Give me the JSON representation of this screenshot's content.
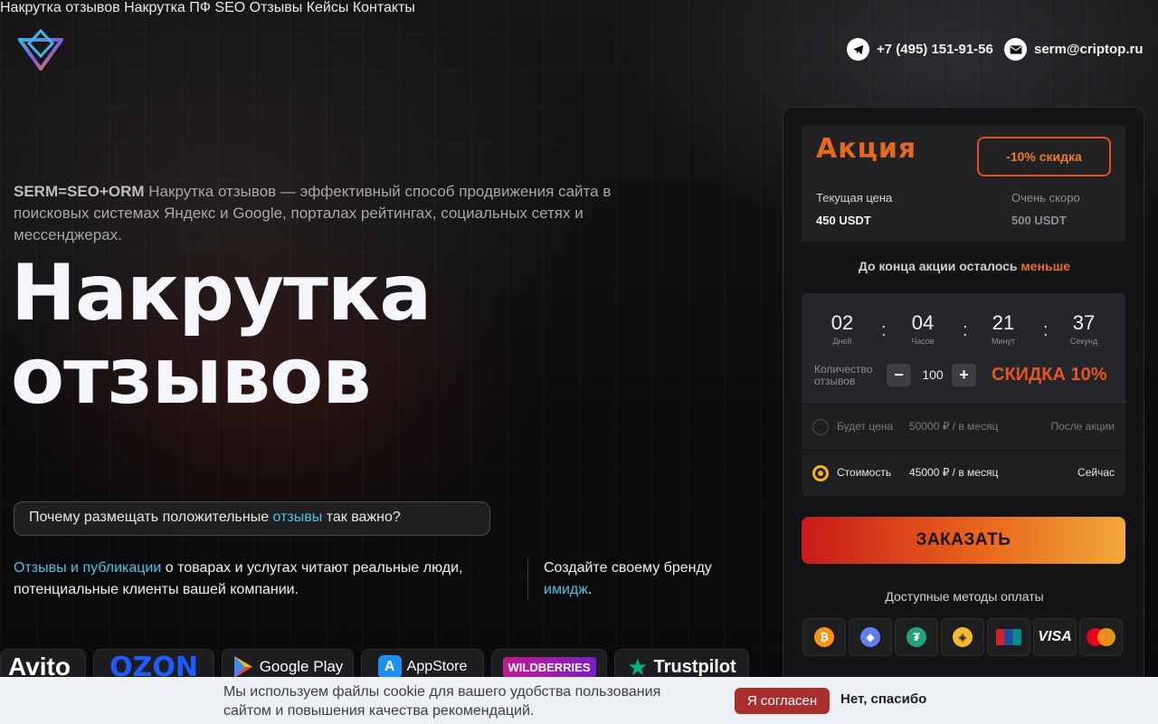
{
  "header": {
    "nav": [
      "Накрутка отзывов",
      "Накрутка ПФ",
      "SEO",
      "Отзывы",
      "Кейсы",
      "Контакты"
    ],
    "phone": "+7 (495) 151-91-56",
    "email": "serm@criptop.ru"
  },
  "hero": {
    "lead_bold": "SERM=SEO+ORM",
    "lead_text": " Накрутка отзывов — эффективный способ продвижения сайта в поисковых системах Яндекс и Google, порталах рейтингах, социальных сетях и мессенджерах.",
    "title_line1": "Накрутка",
    "title_line2": "отзывов",
    "why_pre": "Почему размещать положительные ",
    "why_accent": "отзывы",
    "why_post": " так важно?",
    "para1_accent": "Отзывы и публикации",
    "para1_text": " о товарах и услугах читают реальные люди, потенциальные клиенты вашей компании.",
    "para2_pre": "Создайте своему бренду ",
    "para2_accent": "имидж",
    "para2_post": "."
  },
  "brands": [
    "Avito",
    "OZON",
    "Google Play",
    "AppStore",
    "WILDBERRIES",
    "Trustpilot"
  ],
  "promo": {
    "title": "Акция",
    "discount": "-10% скидка",
    "current_label": "Текущая цена",
    "current_value": "450 USDT",
    "soon_label": "Очень скоро",
    "soon_value": "500 USDT",
    "left_pre": "До конца акции осталось ",
    "left_accent": "меньше",
    "timer": [
      {
        "value": "02",
        "label": "Дней"
      },
      {
        "value": "04",
        "label": "Часов"
      },
      {
        "value": "21",
        "label": "Минут"
      },
      {
        "value": "37",
        "label": "Секунд"
      }
    ],
    "qty_label": "Количество отзывов",
    "qty_value": "100",
    "skidka": "СКИДКА 10%",
    "opt1": {
      "label": "Будет цена",
      "price": "50000 ₽ / в месяц",
      "when": "После акции"
    },
    "opt2": {
      "label": "Стоимость",
      "price": "45000 ₽ / в месяц",
      "when": "Сейчас"
    },
    "order": "ЗАКАЗАТЬ",
    "payment_title": "Доступные методы оплаты"
  },
  "cookie": {
    "text": "Мы используем файлы cookie для вашего удобства пользования сайтом и повышения качества рекомендаций.",
    "agree": "Я согласен",
    "decline": "Нет, спасибо"
  }
}
